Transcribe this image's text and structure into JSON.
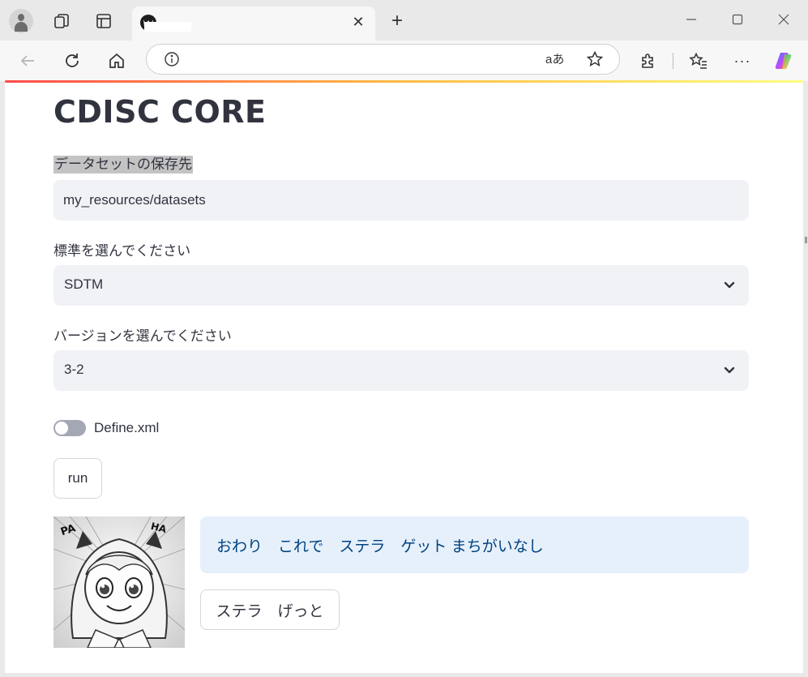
{
  "browser": {
    "tab_close": "✕",
    "new_tab": "+",
    "read_aloud": "aあ",
    "more": "···",
    "icons": [
      "profile-icon",
      "collections-icon",
      "vertical-tabs-icon",
      "back-icon",
      "reload-icon",
      "home-icon",
      "info-icon",
      "favorite-star-icon",
      "extensions-icon",
      "favorites-icon",
      "copilot-icon"
    ]
  },
  "app": {
    "title": "CDISC CORE",
    "dataset_label": "データセットの保存先",
    "dataset_value": "my_resources/datasets",
    "standard_label": "標準を選んでください",
    "standard_value": "SDTM",
    "version_label": "バージョンを選んでください",
    "version_value": "3-2",
    "define_toggle_label": "Define.xml",
    "define_toggle_on": false,
    "run_label": "run",
    "info_message": "おわり　これで　ステラ　ゲット まちがいなし",
    "stella_button_label": "ステラ　げっと",
    "image_text_left": "PA",
    "image_text_right": "HA"
  },
  "colors": {
    "accent_gradient": [
      "#ff4b4b",
      "#ffbd45",
      "#fffd80"
    ],
    "input_bg": "#f0f2f6",
    "info_bg": "#e6f0fb",
    "info_text": "#004280"
  }
}
